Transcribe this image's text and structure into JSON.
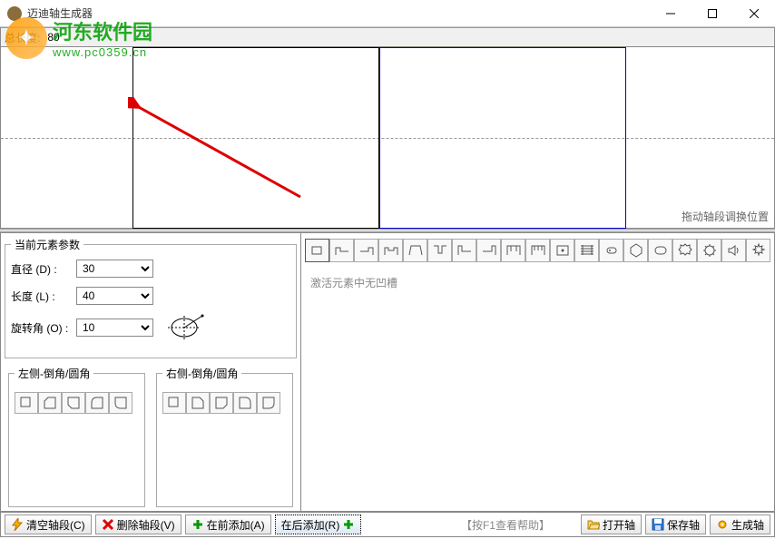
{
  "window": {
    "title": "迈迪轴生成器"
  },
  "watermark": {
    "name": "河东软件园",
    "url": "www.pc0359.cn"
  },
  "infobar": {
    "total_length_label": "总长度:",
    "total_length_value": "80"
  },
  "canvas": {
    "drag_hint": "拖动轴段调换位置"
  },
  "params": {
    "legend": "当前元素参数",
    "diameter_label": "直径 (D) :",
    "diameter_value": "30",
    "length_label": "长度 (L) :",
    "length_value": "40",
    "angle_label": "旋转角 (O) :",
    "angle_value": "10"
  },
  "corners": {
    "left_legend": "左侧-倒角/圆角",
    "right_legend": "右侧-倒角/圆角"
  },
  "rpanel": {
    "message": "激活元素中无凹槽"
  },
  "bottombar": {
    "clear": "清空轴段(C)",
    "delete": "删除轴段(V)",
    "add_before": "在前添加(A)",
    "add_after": "在后添加(R)",
    "help": "【按F1查看帮助】",
    "open": "打开轴",
    "save": "保存轴",
    "generate": "生成轴"
  },
  "icons": {
    "clear": "lightning-icon",
    "delete": "x-icon",
    "add": "plus-icon",
    "open": "folder-open-icon",
    "save": "disk-icon",
    "generate": "gear-icon"
  }
}
